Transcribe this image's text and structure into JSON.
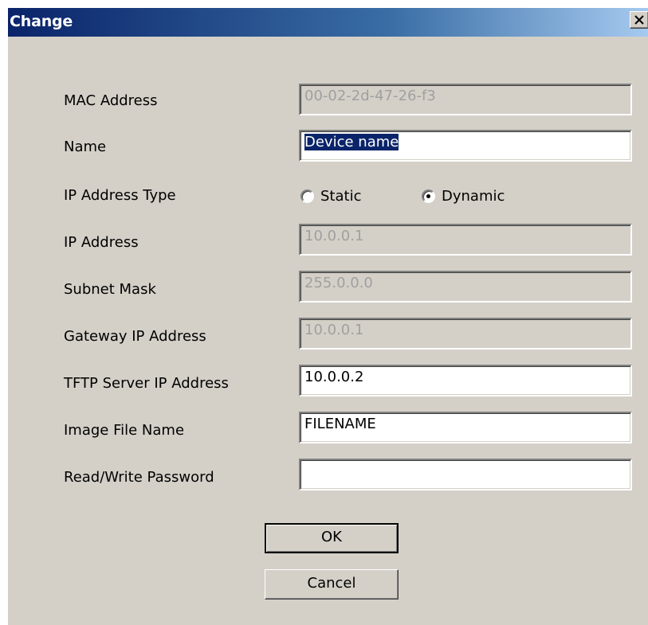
{
  "window": {
    "title": "Change",
    "close_label": "×"
  },
  "fields": {
    "mac_address": {
      "label": "MAC Address",
      "value": "00-02-2d-47-26-f3",
      "enabled": false
    },
    "name": {
      "label": "Name",
      "value": "Device name",
      "enabled": true,
      "text_selected": true
    },
    "ip_address_type": {
      "label": "IP Address Type",
      "options": [
        "Static",
        "Dynamic"
      ],
      "selected": "Dynamic"
    },
    "ip_address": {
      "label": "IP Address",
      "value": "10.0.0.1",
      "enabled": false
    },
    "subnet_mask": {
      "label": "Subnet Mask",
      "value": "255.0.0.0",
      "enabled": false
    },
    "gateway_ip": {
      "label": "Gateway IP Address",
      "value": "10.0.0.1",
      "enabled": false
    },
    "tftp_server_ip": {
      "label": "TFTP Server IP Address",
      "value": "10.0.0.2",
      "enabled": true
    },
    "image_file_name": {
      "label": "Image File Name",
      "value": "FILENAME",
      "enabled": true
    },
    "rw_password": {
      "label": "Read/Write Password",
      "value": "",
      "enabled": true
    }
  },
  "buttons": {
    "ok": "OK",
    "cancel": "Cancel"
  },
  "colors": {
    "title_gradient_start": "#0a246a",
    "title_gradient_end": "#a6caf0",
    "dialog_face": "#d4d0c8",
    "selection": "#0a246a",
    "disabled_text": "#a0a0a0"
  }
}
